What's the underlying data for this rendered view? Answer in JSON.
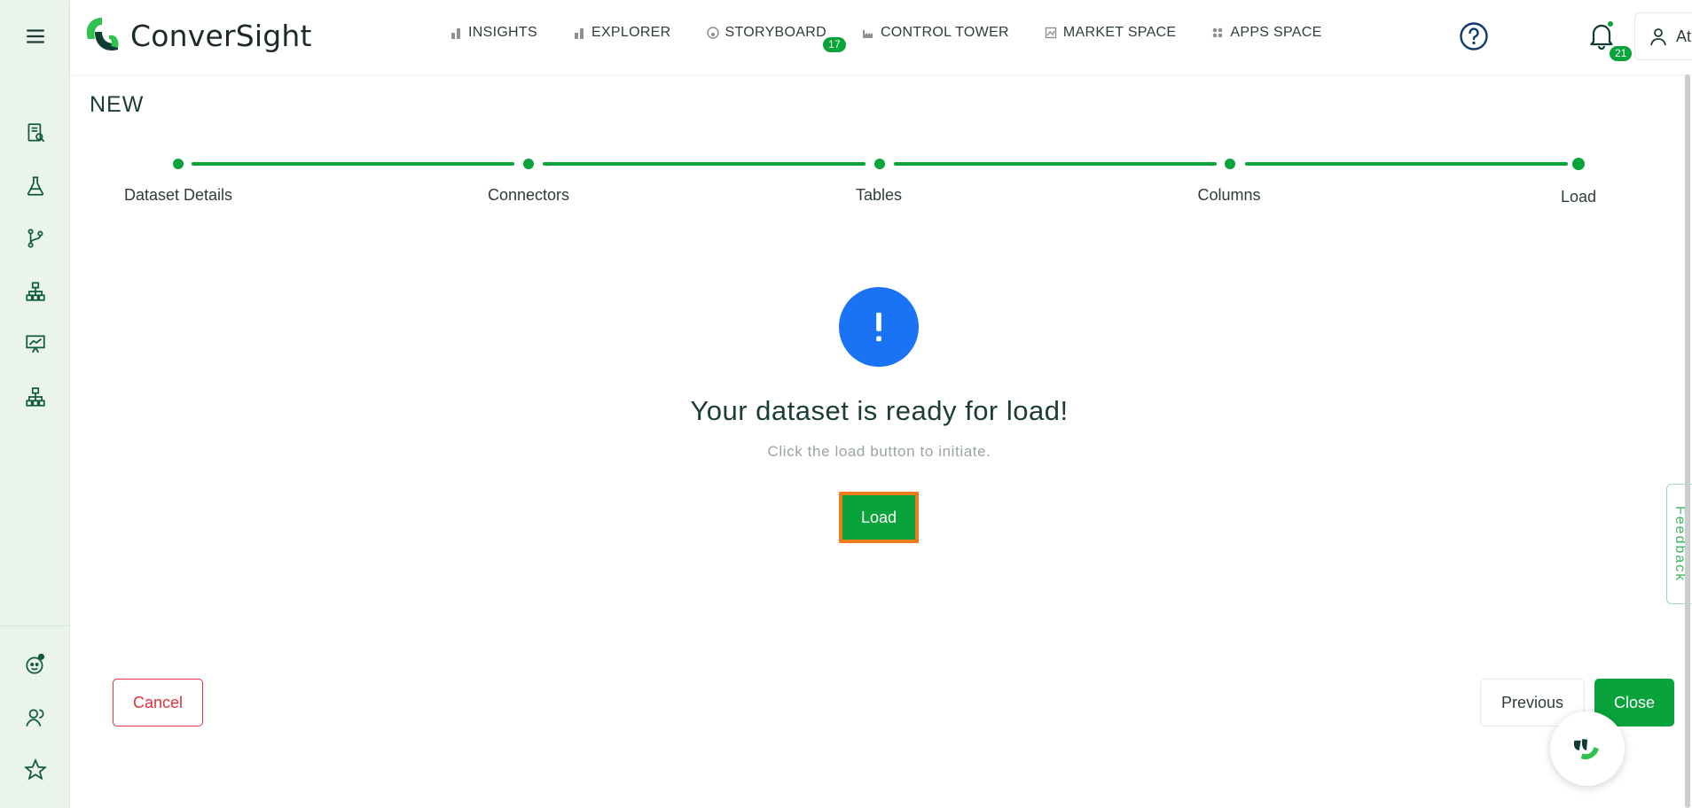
{
  "header": {
    "brand": "ConverSight",
    "nav": [
      {
        "label": "INSIGHTS",
        "icon": "bar-chart-icon"
      },
      {
        "label": "EXPLORER",
        "icon": "bar-chart-icon"
      },
      {
        "label": "STORYBOARD",
        "icon": "palette-icon",
        "badge": "17"
      },
      {
        "label": "CONTROL TOWER",
        "icon": "factory-icon"
      },
      {
        "label": "MARKET SPACE",
        "icon": "market-icon"
      },
      {
        "label": "APPS SPACE",
        "icon": "grid-icon"
      }
    ],
    "notifications_count": "21",
    "user_name": "Athena"
  },
  "sidebar": {
    "top_icons": [
      "menu-icon",
      "report-search-icon",
      "flask-icon",
      "branch-icon",
      "hierarchy-icon",
      "presentation-chart-icon",
      "hierarchy-icon"
    ],
    "bottom_icons": [
      "bot-icon",
      "users-icon",
      "star-icon"
    ]
  },
  "page": {
    "title": "NEW",
    "steps": [
      "Dataset Details",
      "Connectors",
      "Tables",
      "Columns",
      "Load"
    ],
    "ready_title": "Your dataset is ready for load!",
    "ready_subtitle": "Click the load button to initiate.",
    "load_label": "Load",
    "cancel_label": "Cancel",
    "previous_label": "Previous",
    "close_label": "Close",
    "feedback_label": "Feedback"
  },
  "colors": {
    "accent": "#08a33a",
    "alert_blue": "#1a73f5",
    "danger": "#e0303a",
    "highlight": "#f07d1d"
  }
}
